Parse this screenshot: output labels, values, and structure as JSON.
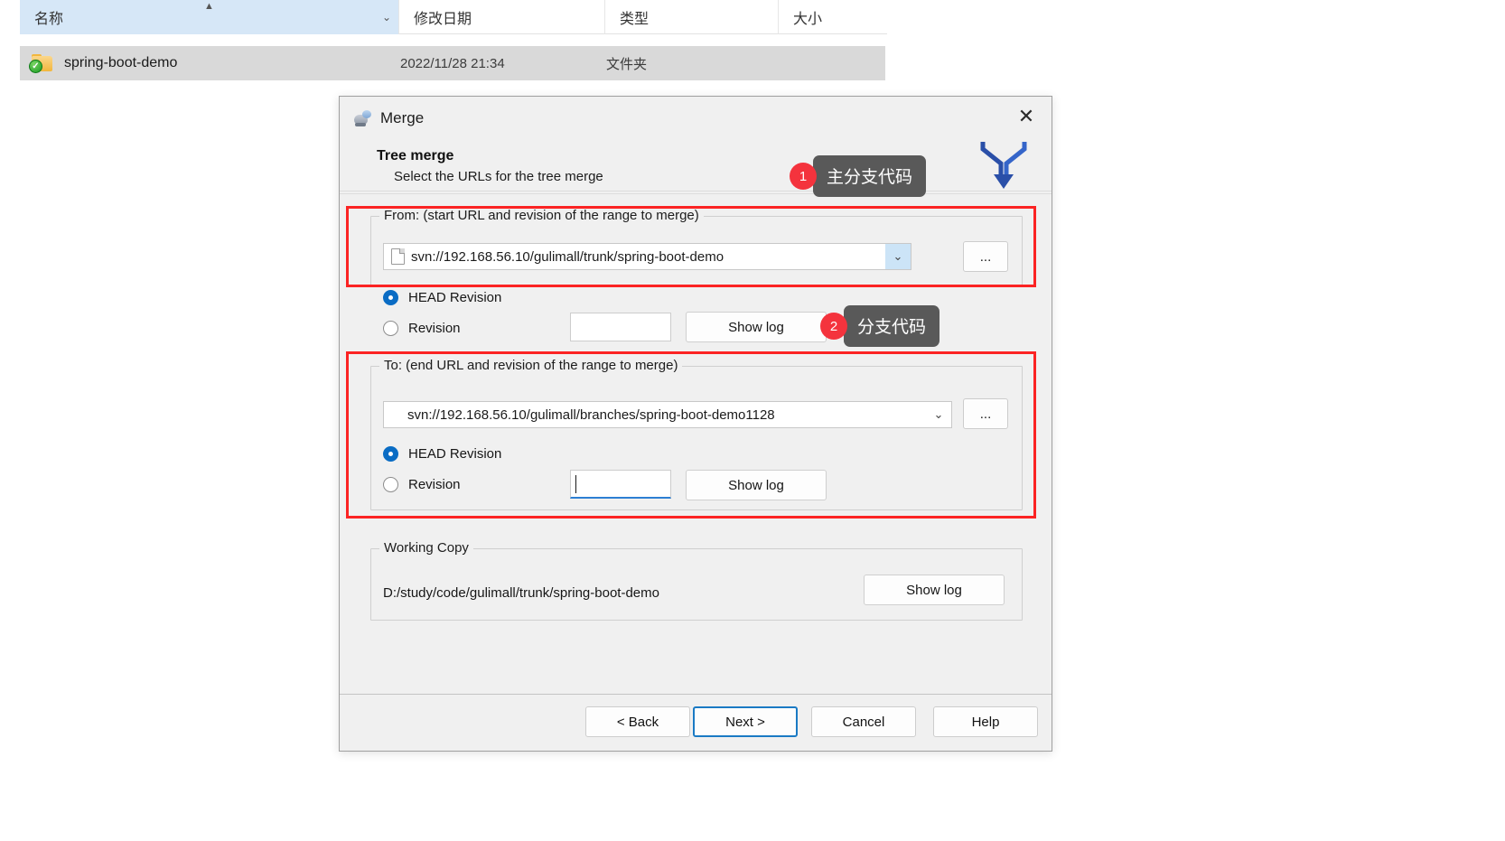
{
  "explorer": {
    "columns": [
      {
        "label": "名称",
        "icon": "sort-ascending-caret"
      },
      {
        "label": "修改日期"
      },
      {
        "label": "类型"
      },
      {
        "label": "大小"
      }
    ],
    "rows": [
      {
        "name": "spring-boot-demo",
        "modified": "2022/11/28 21:34",
        "type": "文件夹",
        "size": "",
        "icon": "folder-versioned-icon"
      }
    ]
  },
  "dialog": {
    "title": "Merge",
    "title_icon": "tortoise-svn-icon",
    "close_icon": "close-icon",
    "header": {
      "heading": "Tree merge",
      "subheading": "Select the URLs for the tree merge",
      "decoration_icon": "merge-arrow-icon"
    },
    "from_group": {
      "legend": "From: (start URL and revision of the range to merge)",
      "url": "svn://192.168.56.10/gulimall/trunk/spring-boot-demo",
      "url_icon": "document-icon",
      "dropdown_icon": "chevron-down-icon",
      "browse_label": "...",
      "head_revision_label": "HEAD Revision",
      "head_revision_selected": true,
      "revision_label": "Revision",
      "revision_selected": false,
      "revision_value": "",
      "show_log_label": "Show log"
    },
    "to_group": {
      "legend": "To: (end URL and revision of the range to merge)",
      "url": "svn://192.168.56.10/gulimall/branches/spring-boot-demo1128",
      "dropdown_icon": "chevron-down-icon",
      "browse_label": "...",
      "head_revision_label": "HEAD Revision",
      "head_revision_selected": true,
      "revision_label": "Revision",
      "revision_selected": false,
      "revision_value": "",
      "show_log_label": "Show log"
    },
    "working_copy": {
      "legend": "Working Copy",
      "path": "D:/study/code/gulimall/trunk/spring-boot-demo",
      "show_log_label": "Show log"
    },
    "footer": {
      "back_label": "< Back",
      "next_label": "Next >",
      "cancel_label": "Cancel",
      "help_label": "Help",
      "focused_button": "next"
    }
  },
  "annotations": {
    "highlight_color": "#fb2323",
    "badge_color": "#f4333d",
    "bubble_color": "#595959",
    "callouts": [
      {
        "number": "1",
        "text": "主分支代码"
      },
      {
        "number": "2",
        "text": "分支代码"
      }
    ]
  }
}
